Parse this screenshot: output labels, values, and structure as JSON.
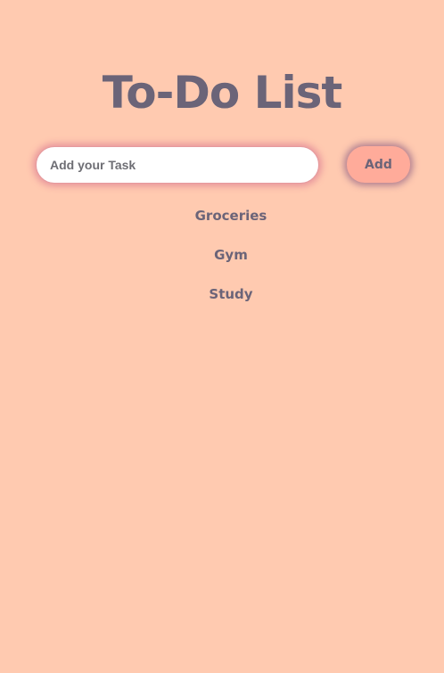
{
  "app": {
    "title": "To-Do List"
  },
  "form": {
    "input_value": "",
    "input_placeholder": "Add your Task",
    "add_label": "Add"
  },
  "tasks": [
    {
      "label": "Groceries"
    },
    {
      "label": "Gym"
    },
    {
      "label": "Study"
    }
  ],
  "colors": {
    "background": "#ffcab0",
    "text": "#6b6478",
    "button": "#ffab9a",
    "input_glow": "#e8959c"
  }
}
